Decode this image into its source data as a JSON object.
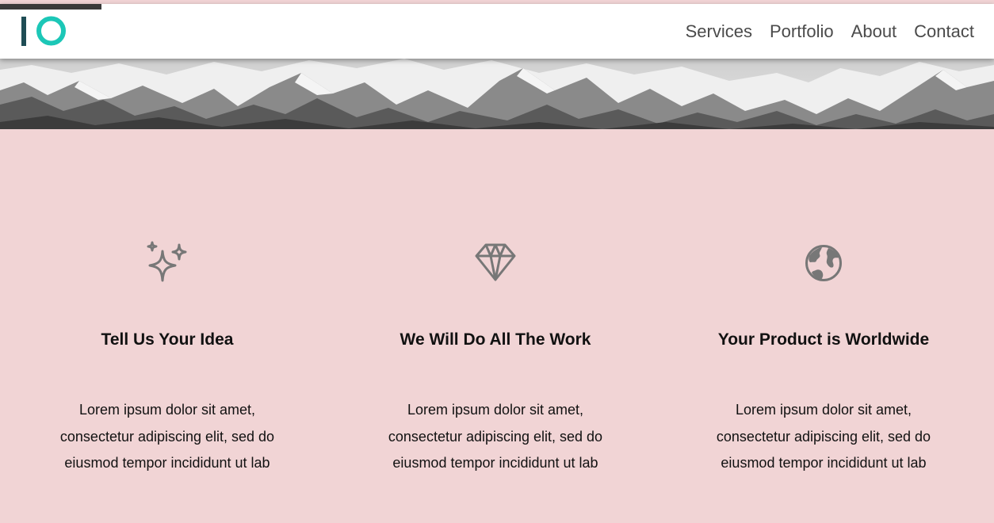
{
  "brand": {
    "logo_text": "IO",
    "colors": {
      "logo_bar": "#3a3a3a",
      "logo_teal": "#1cc7b7",
      "logo_dark": "#1f4d55",
      "background": "#f1d4d5"
    }
  },
  "nav": {
    "items": [
      {
        "label": "Services"
      },
      {
        "label": "Portfolio"
      },
      {
        "label": "About"
      },
      {
        "label": "Contact"
      }
    ]
  },
  "features": [
    {
      "icon": "sparkles-icon",
      "title": "Tell Us Your Idea",
      "text": "Lorem ipsum dolor sit amet, consectetur adipiscing elit, sed do eiusmod tempor incididunt ut lab"
    },
    {
      "icon": "diamond-icon",
      "title": "We Will Do All The Work",
      "text": "Lorem ipsum dolor sit amet, consectetur adipiscing elit, sed do eiusmod tempor incididunt ut lab"
    },
    {
      "icon": "globe-icon",
      "title": "Your Product is Worldwide",
      "text": "Lorem ipsum dolor sit amet, consectetur adipiscing elit, sed do eiusmod tempor incididunt ut lab"
    }
  ]
}
